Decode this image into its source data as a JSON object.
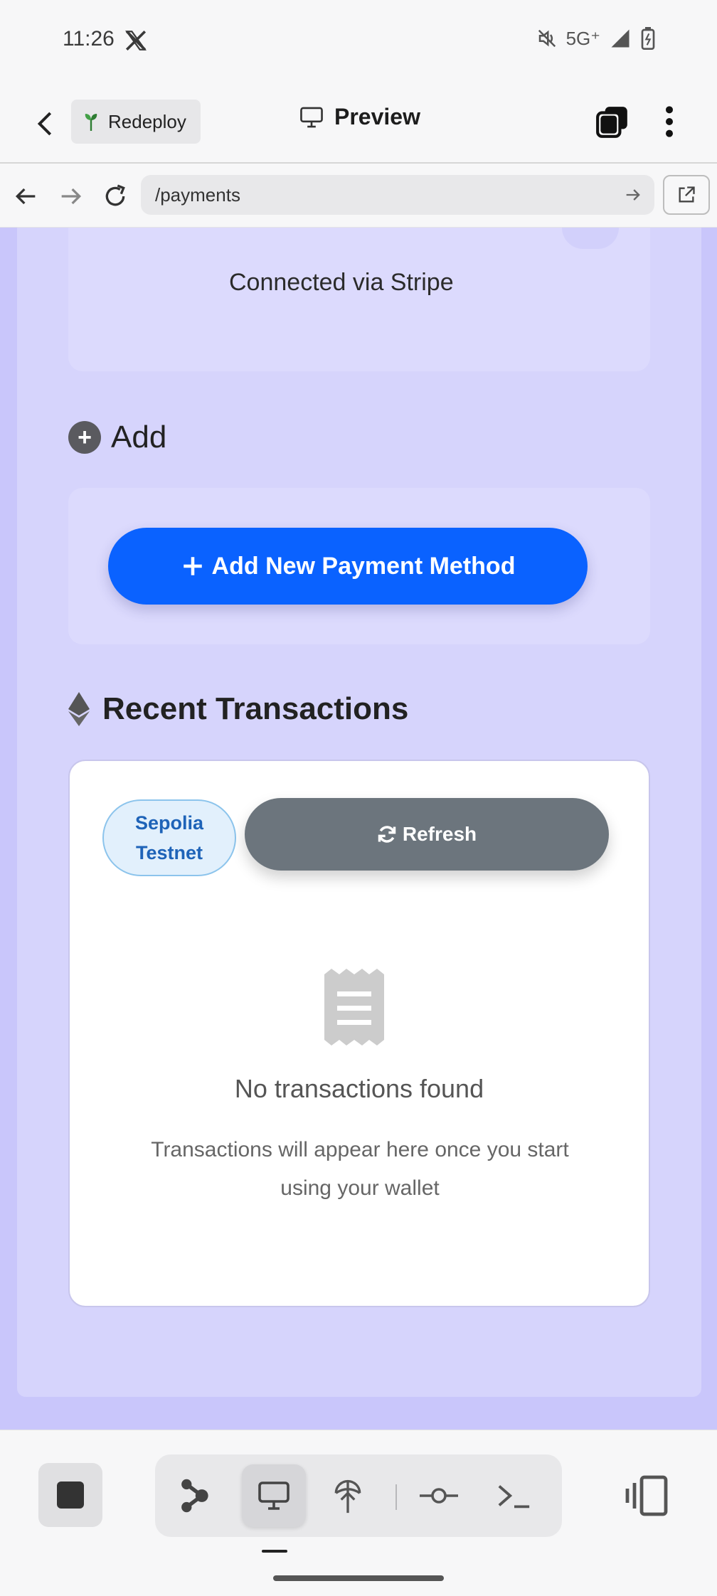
{
  "status_bar": {
    "time": "11:26",
    "network": "5G⁺"
  },
  "header": {
    "redeploy_label": "Redeploy",
    "title": "Preview"
  },
  "browser": {
    "url": "/payments"
  },
  "payment_methods": {
    "connected_text": "Connected via Stripe"
  },
  "add_section": {
    "heading": "Add",
    "button_label": "Add New Payment Method"
  },
  "transactions": {
    "heading": "Recent Transactions",
    "network_badge": "Sepolia Testnet",
    "refresh_label": "Refresh",
    "empty_title": "No transactions found",
    "empty_subtitle": "Transactions will appear here once you start using your wallet"
  },
  "colors": {
    "accent_button": "#0a62ff",
    "page_background": "#c9c6fb",
    "refresh_button": "#6c757d",
    "badge_text": "#1e63b8"
  },
  "icons": {
    "status": [
      "x-logo-icon",
      "mute-icon",
      "signal-icon",
      "battery-icon"
    ],
    "toolbar": [
      "stop-icon",
      "agent-icon",
      "desktop-icon",
      "deploy-icon",
      "git-commit-icon",
      "terminal-icon",
      "panel-toggle-icon"
    ]
  }
}
